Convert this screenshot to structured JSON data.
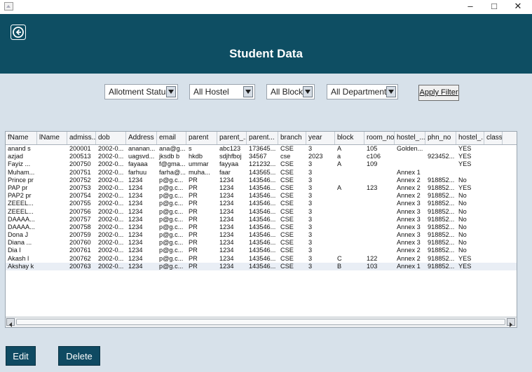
{
  "window": {
    "minimize_label": "–",
    "maximize_label": "□",
    "close_label": "✕"
  },
  "header": {
    "title": "Student Data",
    "background_color": "#0e4e63"
  },
  "filters": {
    "allotment_status": "Allotment Status",
    "hostel": "All Hostel",
    "blocks": "All Blocks",
    "departments": "All Departments",
    "apply_label": "Apply Filter"
  },
  "table": {
    "columns": [
      "fName",
      "lName",
      "admiss...",
      "dob",
      "Address",
      "email",
      "parent",
      "parent_...",
      "parent...",
      "branch",
      "year",
      "block",
      "room_no",
      "hostel_...",
      "phn_no",
      "hostel_...",
      "class"
    ],
    "rows": [
      [
        "anand s",
        "",
        "200001",
        "2002-0...",
        "ananan...",
        "ana@g...",
        "s",
        "abc123",
        "173645...",
        "CSE",
        "3",
        "A",
        "105",
        "Golden...",
        "",
        "YES",
        ""
      ],
      [
        "azjad",
        "",
        "200513",
        "2002-0...",
        "uagsvd...",
        "jksdb b",
        "hkdb",
        "sdjhfboj",
        "34567",
        "cse",
        "2023",
        "a",
        "c106",
        "",
        "923452...",
        "YES",
        ""
      ],
      [
        "Fayiz ...",
        "",
        "200750",
        "2002-0...",
        "fayaaa",
        "f@gma...",
        "ummar",
        "fayyaa",
        "121232...",
        "CSE",
        "3",
        "A",
        "109",
        "",
        "",
        "YES",
        ""
      ],
      [
        "Muham...",
        "",
        "200751",
        "2002-0...",
        "farhuu",
        "farha@...",
        "muha...",
        "faar",
        "143565...",
        "CSE",
        "3",
        "",
        "",
        "Annex 1",
        "",
        "",
        ""
      ],
      [
        "Prince pr",
        "",
        "200752",
        "2002-0...",
        "1234",
        "p@g.c...",
        "PR",
        "1234",
        "143546...",
        "CSE",
        "3",
        "",
        "",
        "Annex 2",
        "918852...",
        "No",
        ""
      ],
      [
        "PAP pr",
        "",
        "200753",
        "2002-0...",
        "1234",
        "p@g.c...",
        "PR",
        "1234",
        "143546...",
        "CSE",
        "3",
        "A",
        "123",
        "Annex 2",
        "918852...",
        "YES",
        ""
      ],
      [
        "PAP2 pr",
        "",
        "200754",
        "2002-0...",
        "1234",
        "p@g.c...",
        "PR",
        "1234",
        "143546...",
        "CSE",
        "3",
        "",
        "",
        "Annex 2",
        "918852...",
        "No",
        ""
      ],
      [
        "ZEEEL...",
        "",
        "200755",
        "2002-0...",
        "1234",
        "p@g.c...",
        "PR",
        "1234",
        "143546...",
        "CSE",
        "3",
        "",
        "",
        "Annex 3",
        "918852...",
        "No",
        ""
      ],
      [
        "ZEEEL...",
        "",
        "200756",
        "2002-0...",
        "1234",
        "p@g.c...",
        "PR",
        "1234",
        "143546...",
        "CSE",
        "3",
        "",
        "",
        "Annex 3",
        "918852...",
        "No",
        ""
      ],
      [
        "DAAAA...",
        "",
        "200757",
        "2002-0...",
        "1234",
        "p@g.c...",
        "PR",
        "1234",
        "143546...",
        "CSE",
        "3",
        "",
        "",
        "Annex 3",
        "918852...",
        "No",
        ""
      ],
      [
        "DAAAA...",
        "",
        "200758",
        "2002-0...",
        "1234",
        "p@g.c...",
        "PR",
        "1234",
        "143546...",
        "CSE",
        "3",
        "",
        "",
        "Annex 3",
        "918852...",
        "No",
        ""
      ],
      [
        "Dona J",
        "",
        "200759",
        "2002-0...",
        "1234",
        "p@g.c...",
        "PR",
        "1234",
        "143546...",
        "CSE",
        "3",
        "",
        "",
        "Annex 3",
        "918852...",
        "No",
        ""
      ],
      [
        "Diana ...",
        "",
        "200760",
        "2002-0...",
        "1234",
        "p@g.c...",
        "PR",
        "1234",
        "143546...",
        "CSE",
        "3",
        "",
        "",
        "Annex 3",
        "918852...",
        "No",
        ""
      ],
      [
        "Dia l",
        "",
        "200761",
        "2002-0...",
        "1234",
        "p@g.c...",
        "PR",
        "1234",
        "143546...",
        "CSE",
        "3",
        "",
        "",
        "Annex 2",
        "918852...",
        "No",
        ""
      ],
      [
        "Akash l",
        "",
        "200762",
        "2002-0...",
        "1234",
        "p@g.c...",
        "PR",
        "1234",
        "143546...",
        "CSE",
        "3",
        "C",
        "122",
        "Annex 2",
        "918852...",
        "YES",
        ""
      ],
      [
        "Akshay k",
        "",
        "200763",
        "2002-0...",
        "1234",
        "p@g.c...",
        "PR",
        "1234",
        "143546...",
        "CSE",
        "3",
        "B",
        "103",
        "Annex 1",
        "918852...",
        "YES",
        ""
      ]
    ]
  },
  "actions": {
    "edit_label": "Edit",
    "delete_label": "Delete"
  }
}
